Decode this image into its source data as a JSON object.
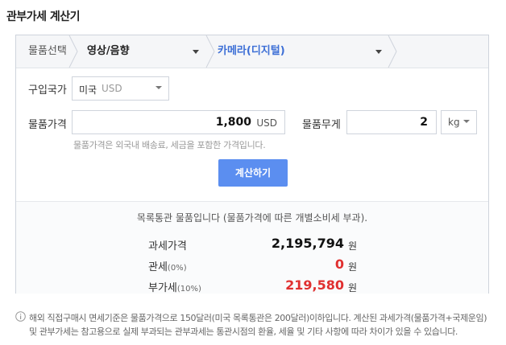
{
  "page": {
    "title": "관부가세 계산기"
  },
  "breadcrumb": {
    "label": "물품선택",
    "category": "영상/음향",
    "subcategory": "카메라(디지털)"
  },
  "form": {
    "country_label": "구입국가",
    "country_value": "미국",
    "country_currency": "USD",
    "price_label": "물품가격",
    "price_value": "1,800",
    "price_unit": "USD",
    "weight_label": "물품무게",
    "weight_value": "2",
    "weight_unit": "kg",
    "price_help": "물품가격은 외국내 배송료, 세금을 포함한 가격입니다.",
    "calc_button": "계산하기"
  },
  "result": {
    "message": "목록통관 물품입니다 (물품가격에 따른 개별소비세 부과).",
    "rows": [
      {
        "label": "과세가격",
        "sub": "",
        "value": "2,195,794",
        "unit": "원",
        "color": "#111111"
      },
      {
        "label": "관세",
        "sub": "(0%)",
        "value": "0",
        "unit": "원",
        "color": "#e03030"
      },
      {
        "label": "부가세",
        "sub": "(10%)",
        "value": "219,580",
        "unit": "원",
        "color": "#e03030"
      }
    ]
  },
  "notes": {
    "line1": "해외 직접구매시 면세기준은 물품가격으로 150달러(미국 목록통관은 200달러)이하입니다. 계산된 과세가격(물품가격+국제운임)",
    "line2": "및 관부가세는 참고용으로 실제 부과되는 관부과세는 통관시점의 환율, 세율 및 기타 사항에 따라 차이가 있을 수 있습니다."
  },
  "colors": {
    "accent": "#5b8ef0",
    "red": "#e03030"
  }
}
